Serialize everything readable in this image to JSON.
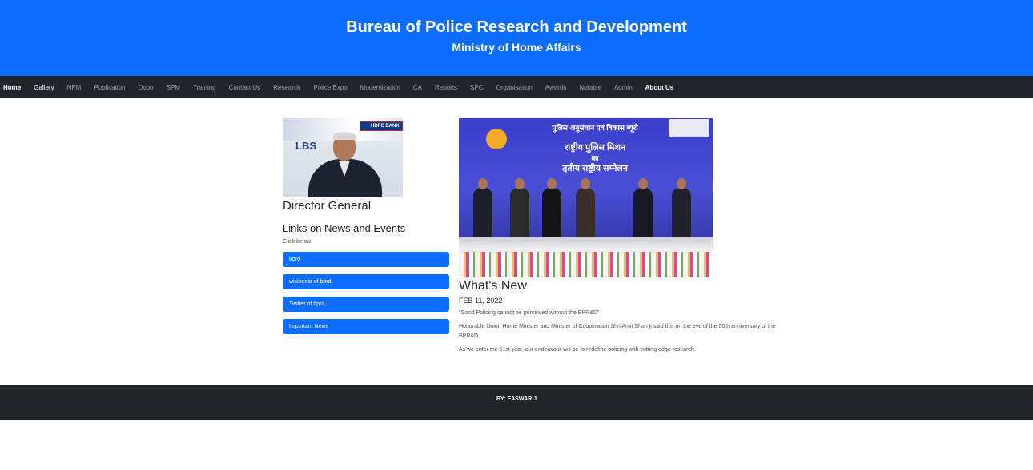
{
  "header": {
    "title": "Bureau of Police Research and Development",
    "subtitle": "Ministry of Home Affairs"
  },
  "nav": {
    "items": [
      {
        "label": "Home"
      },
      {
        "label": "Gallery"
      },
      {
        "label": "NPM"
      },
      {
        "label": "Publication"
      },
      {
        "label": "Dopo"
      },
      {
        "label": "SPM"
      },
      {
        "label": "Training"
      },
      {
        "label": "Contact Us"
      },
      {
        "label": "Research"
      },
      {
        "label": "Police Expo"
      },
      {
        "label": "Modernization"
      },
      {
        "label": "CA"
      },
      {
        "label": "Reports"
      },
      {
        "label": "SPC"
      },
      {
        "label": "Organisation"
      },
      {
        "label": "Awards"
      },
      {
        "label": "Notable"
      },
      {
        "label": "Admin"
      },
      {
        "label": "About Us"
      }
    ]
  },
  "left": {
    "dg_heading": "Director General",
    "links_heading": "Links on News and Events",
    "click_below": "Click below",
    "photo_text": {
      "bank": "HDFC BANK",
      "lbs": "LBS"
    },
    "buttons": [
      {
        "label": "bprd"
      },
      {
        "label": "wikipedia of bprd"
      },
      {
        "label": "Twitter of bprd"
      },
      {
        "label": "Important News"
      }
    ]
  },
  "right": {
    "photo_text": {
      "line1": "पुलिस अनुसंधान एवं विकास ब्यूरो",
      "line2": "राष्ट्रीय पुलिस मिशन",
      "line3": "का",
      "line4": "तृतीय राष्ट्रीय सम्मेलन"
    },
    "whats_new": "What's New",
    "date": "FEB 11, 2022",
    "quote": "\"Good Policing cannot be perceived without the BPR&D\"",
    "para1": "Honurable Union Home Minister and Minister of Cooperation Shri Amit Shah ji said this on the eve of the 50th anniversary of the BPR&D.",
    "para2": "As we enter the 51st year, our endeavour will be to redefine policing with cutting edge research."
  },
  "footer": {
    "credit": "BY: EASWAR J"
  },
  "colors": {
    "primary": "#0d6efd",
    "dark": "#212529"
  }
}
